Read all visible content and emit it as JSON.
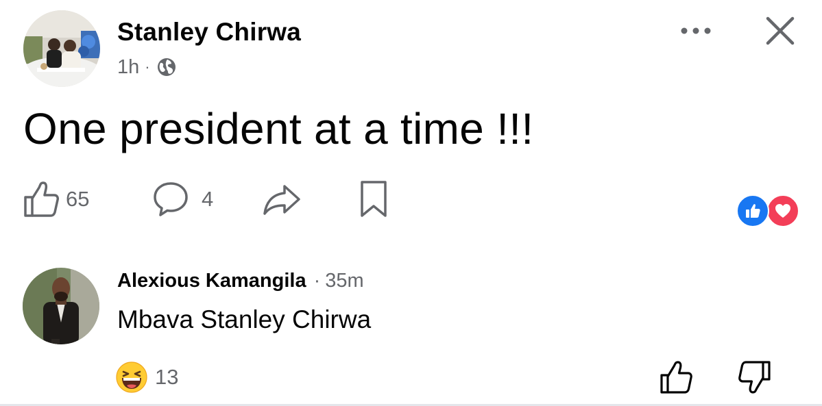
{
  "post": {
    "author": "Stanley Chirwa",
    "time": "1h",
    "separator": "·",
    "audience_icon": "globe-icon",
    "text": "One president at a time !!!",
    "likes": "65",
    "comments": "4"
  },
  "header_actions": {
    "more_icon": "more-horizontal-icon",
    "close_icon": "close-icon"
  },
  "actions": {
    "like_icon": "thumbs-up-outline-icon",
    "comment_icon": "comment-bubble-icon",
    "share_icon": "share-arrow-icon",
    "save_icon": "bookmark-icon"
  },
  "reactions_summary": [
    "like",
    "love"
  ],
  "comment": {
    "author": "Alexious Kamangila",
    "separator": "·",
    "time": "35m",
    "text": "Mbava Stanley Chirwa",
    "reaction_emoji": "grinning-squinting-face",
    "reaction_count": "13"
  },
  "colors": {
    "text": "#050505",
    "secondary": "#65676b",
    "like_blue": "#1877f2",
    "love_red": "#f33e58",
    "emoji_yellow": "#ffcc33"
  }
}
